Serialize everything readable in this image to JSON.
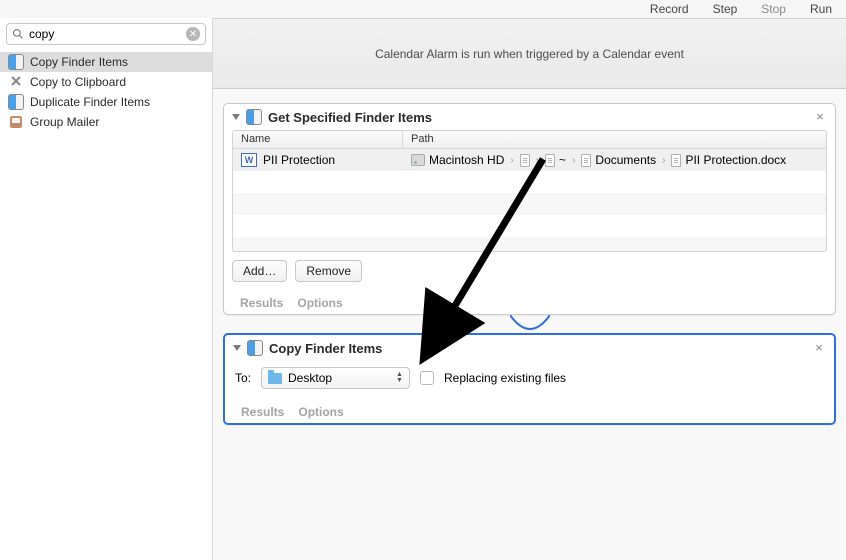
{
  "toolbar": {
    "record": "Record",
    "step": "Step",
    "stop": "Stop",
    "run": "Run"
  },
  "search": {
    "value": "copy"
  },
  "sidebar_actions": [
    {
      "label": "Copy Finder Items",
      "icon": "finder",
      "selected": true
    },
    {
      "label": "Copy to Clipboard",
      "icon": "clipboard",
      "selected": false
    },
    {
      "label": "Duplicate Finder Items",
      "icon": "finder",
      "selected": false
    },
    {
      "label": "Group Mailer",
      "icon": "contacts",
      "selected": false
    }
  ],
  "info_bar": "Calendar Alarm is run when triggered by a Calendar event",
  "action1": {
    "title": "Get Specified Finder Items",
    "col_name": "Name",
    "col_path": "Path",
    "file_name": "PII Protection",
    "path_parts": [
      "Macintosh HD",
      "",
      "~",
      "",
      "Documents",
      "",
      "PII Protection.docx"
    ],
    "drive_label": "Macintosh HD",
    "tilde": "~",
    "documents": "Documents",
    "docx": "PII Protection.docx",
    "add_btn": "Add…",
    "remove_btn": "Remove",
    "results": "Results",
    "options": "Options"
  },
  "action2": {
    "title": "Copy Finder Items",
    "to_label": "To:",
    "dest": "Desktop",
    "replace_label": "Replacing existing files",
    "results": "Results",
    "options": "Options"
  }
}
